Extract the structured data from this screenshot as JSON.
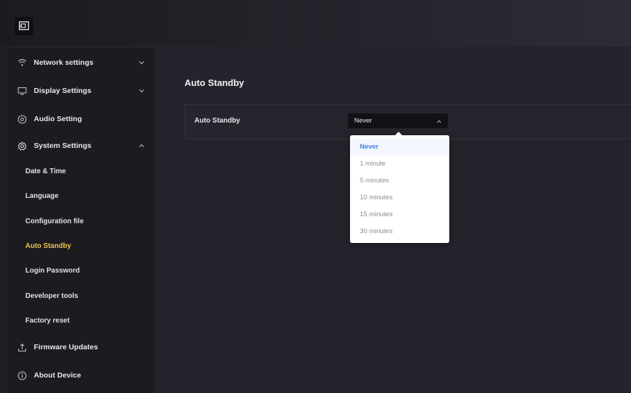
{
  "sidebar": {
    "network": "Network settings",
    "display": "Display Settings",
    "audio": "Audio Setting",
    "system": "System Settings",
    "sub": [
      "Date & Time",
      "Language",
      "Configuration file",
      "Auto Standby",
      "Login Password",
      "Developer tools",
      "Factory reset"
    ],
    "firmware": "Firmware Updates",
    "about": "About Device"
  },
  "main": {
    "title": "Auto Standby",
    "setting_label": "Auto Standby",
    "selected_value": "Never"
  },
  "dropdown": {
    "options": [
      "Never",
      "1 minute",
      "5 minutes",
      "10 minutes",
      "15 minutes",
      "30 minutes"
    ]
  },
  "colors": {
    "active_item": "#f0c24a",
    "selected_option": "#3d7fe6"
  }
}
